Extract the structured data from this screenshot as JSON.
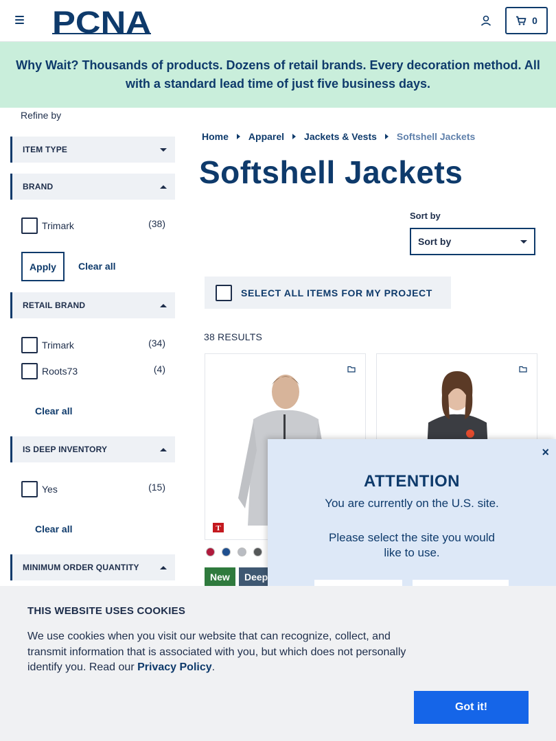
{
  "header": {
    "logo_text": "PCNA",
    "cart_count": "0"
  },
  "banner": {
    "text": "Why Wait? Thousands of products. Dozens of retail brands. Every decoration method. All with a standard lead time of just five business days."
  },
  "sidebar": {
    "refine_label": "Refine by",
    "facets": {
      "item_type": "ITEM TYPE",
      "brand": "BRAND",
      "retail_brand": "RETAIL BRAND",
      "deep_inventory": "IS DEEP INVENTORY",
      "min_order_qty": "MINIMUM ORDER QUANTITY"
    },
    "brand_options": [
      {
        "name": "Trimark",
        "count": "(38)"
      }
    ],
    "retail_brand_options": [
      {
        "name": "Trimark",
        "count": "(34)"
      },
      {
        "name": "Roots73",
        "count": "(4)"
      }
    ],
    "deep_inventory_options": [
      {
        "name": "Yes",
        "count": "(15)"
      }
    ],
    "apply_label": "Apply",
    "clear_all_label": "Clear all"
  },
  "breadcrumb": {
    "items": [
      "Home",
      "Apparel",
      "Jackets & Vests"
    ],
    "current": "Softshell Jackets"
  },
  "page_title": "Softshell Jackets",
  "sort": {
    "label": "Sort by",
    "value": "Sort by"
  },
  "select_all_label": "SELECT ALL ITEMS FOR MY PROJECT",
  "results_count": "38 RESULTS",
  "product": {
    "swatch_colors": [
      "#b01a3c",
      "#1f4f8f",
      "#b9bcc2",
      "#555859"
    ],
    "badges": [
      {
        "text": "New",
        "color": "#2f7a3d"
      },
      {
        "text": "Deep",
        "color": "#3f5872"
      }
    ],
    "brand_badge": "T"
  },
  "modal": {
    "title": "ATTENTION",
    "line1": "You are currently on the U.S. site.",
    "line2": "Please select the site you would like to use.",
    "close": "×"
  },
  "cookie": {
    "title": "THIS WEBSITE USES COOKIES",
    "text": "We use cookies when you visit our website that can recognize, collect, and transmit information that is associated with you, but which does not personally identify you. Read our",
    "policy_link": "Privacy Policy",
    "period": ".",
    "button": "Got it!"
  }
}
